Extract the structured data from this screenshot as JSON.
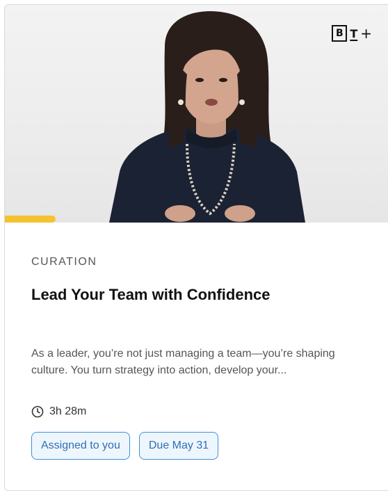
{
  "card": {
    "brand": {
      "box_letter": "B",
      "letter": "T",
      "plus": "+"
    },
    "progress_fraction": 0.13,
    "progress_color": "#f5c230",
    "category": "CURATION",
    "title": "Lead Your Team with Confidence",
    "description": "As a leader, you’re not just managing a team—you’re shaping culture. You turn strategy into action, develop your...",
    "duration": "3h 28m",
    "tags": [
      "Assigned to you",
      "Due May 31"
    ],
    "tag_color": "#2e6fb5"
  }
}
